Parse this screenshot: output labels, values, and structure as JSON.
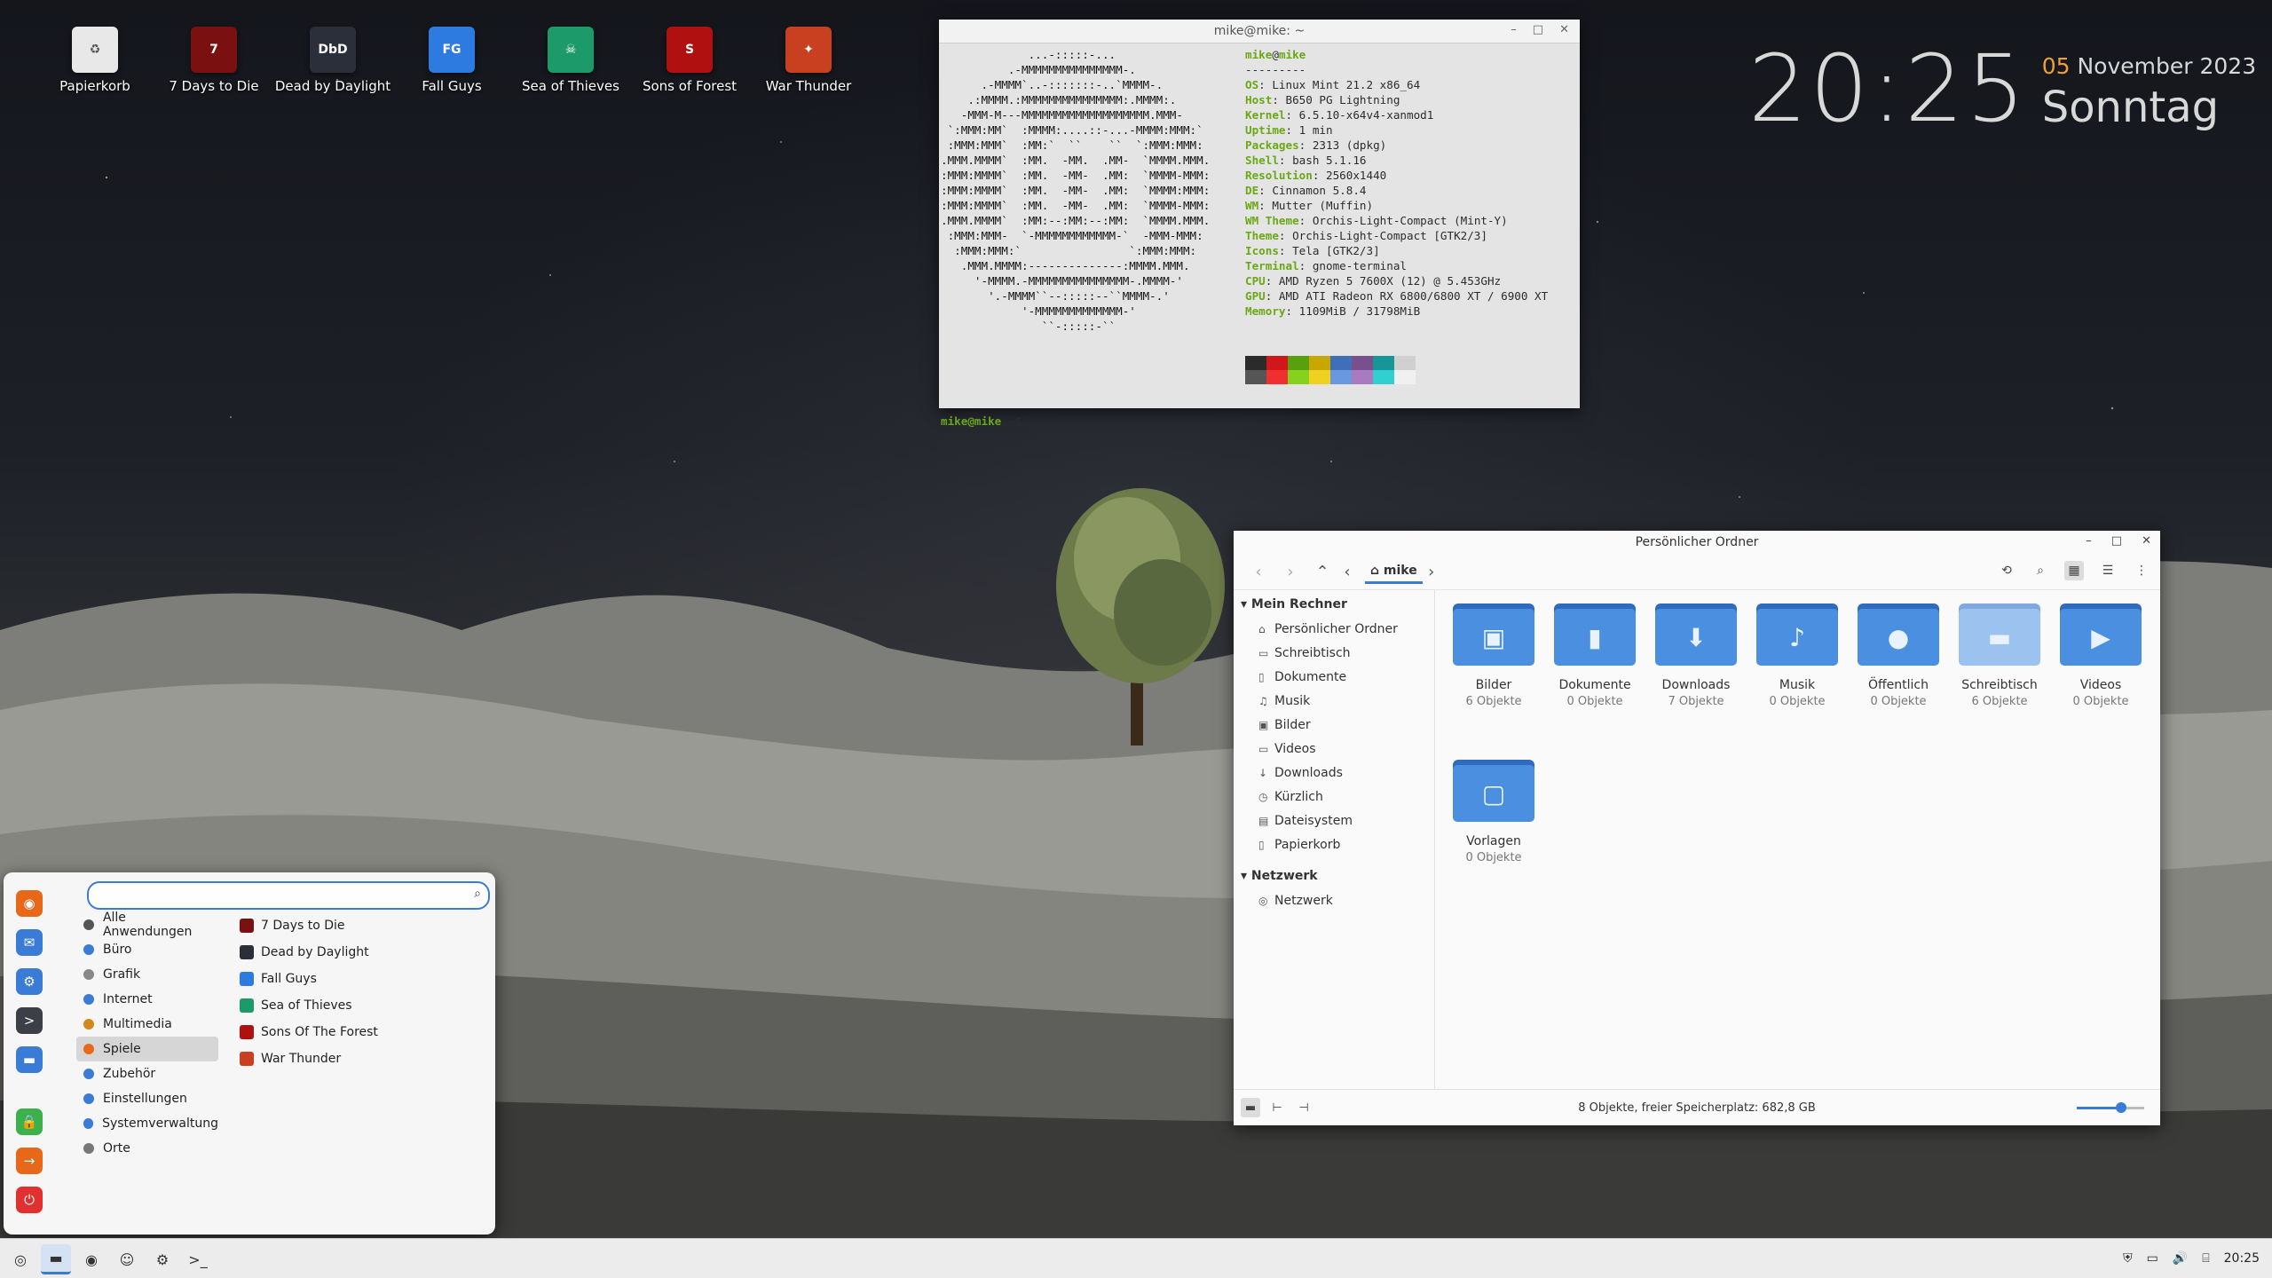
{
  "desktop": {
    "icons": [
      {
        "label": "Papierkorb",
        "color": "#e8e8e8",
        "glyph": "♻"
      },
      {
        "label": "7 Days to Die",
        "color": "#7a1010",
        "glyph": "7"
      },
      {
        "label": "Dead by Daylight",
        "color": "#2a2f3a",
        "glyph": "DbD"
      },
      {
        "label": "Fall Guys",
        "color": "#2d7be0",
        "glyph": "FG"
      },
      {
        "label": "Sea of Thieves",
        "color": "#1c9a6a",
        "glyph": "☠"
      },
      {
        "label": "Sons of Forest",
        "color": "#b01010",
        "glyph": "S"
      },
      {
        "label": "War Thunder",
        "color": "#c84020",
        "glyph": "✦"
      }
    ]
  },
  "clock": {
    "time": "20:25",
    "day_num": "05",
    "month_year": "November 2023",
    "weekday": "Sonntag"
  },
  "terminal": {
    "title": "mike@mike: ~",
    "user": "mike",
    "at": "@",
    "host": "mike",
    "separator": "---------",
    "info": [
      {
        "key": "OS",
        "value": "Linux Mint 21.2 x86_64"
      },
      {
        "key": "Host",
        "value": "B650 PG Lightning"
      },
      {
        "key": "Kernel",
        "value": "6.5.10-x64v4-xanmod1"
      },
      {
        "key": "Uptime",
        "value": "1 min"
      },
      {
        "key": "Packages",
        "value": "2313 (dpkg)"
      },
      {
        "key": "Shell",
        "value": "bash 5.1.16"
      },
      {
        "key": "Resolution",
        "value": "2560x1440"
      },
      {
        "key": "DE",
        "value": "Cinnamon 5.8.4"
      },
      {
        "key": "WM",
        "value": "Mutter (Muffin)"
      },
      {
        "key": "WM Theme",
        "value": "Orchis-Light-Compact (Mint-Y)"
      },
      {
        "key": "Theme",
        "value": "Orchis-Light-Compact [GTK2/3]"
      },
      {
        "key": "Icons",
        "value": "Tela [GTK2/3]"
      },
      {
        "key": "Terminal",
        "value": "gnome-terminal"
      },
      {
        "key": "CPU",
        "value": "AMD Ryzen 5 7600X (12) @ 5.453GHz"
      },
      {
        "key": "GPU",
        "value": "AMD ATI Radeon RX 6800/6800 XT / 6900 XT"
      },
      {
        "key": "Memory",
        "value": "1109MiB / 31798MiB"
      }
    ],
    "ascii": [
      "             ...-:::::-...",
      "          .-MMMMMMMMMMMMMMM-.",
      "      .-MMMM`..-:::::::-..`MMMM-.",
      "    .:MMMM.:MMMMMMMMMMMMMMM:.MMMM:.",
      "   -MMM-M---MMMMMMMMMMMMMMMMMMM.MMM-",
      " `:MMM:MM`  :MMMM:....::-...-MMMM:MMM:`",
      " :MMM:MMM`  :MM:`  ``    ``  `:MMM:MMM:",
      ".MMM.MMMM`  :MM.  -MM.  .MM-  `MMMM.MMM.",
      ":MMM:MMMM`  :MM.  -MM-  .MM:  `MMMM-MMM:",
      ":MMM:MMMM`  :MM.  -MM-  .MM:  `MMMM:MMM:",
      ":MMM:MMMM`  :MM.  -MM-  .MM:  `MMMM-MMM:",
      ".MMM.MMMM`  :MM:--:MM:--:MM:  `MMMM.MMM.",
      " :MMM:MMM-  `-MMMMMMMMMMMM-`  -MMM-MMM:",
      "  :MMM:MMM:`                `:MMM:MMM:",
      "   .MMM.MMMM:--------------:MMMM.MMM.",
      "     '-MMMM.-MMMMMMMMMMMMMMM-.MMMM-'",
      "       '.-MMMM``--:::::--``MMMM-.'",
      "            '-MMMMMMMMMMMMM-'",
      "               ``-:::::-``"
    ],
    "swatches_top": [
      "#2b2b2b",
      "#d01818",
      "#58a00e",
      "#c8a800",
      "#3f6fb8",
      "#7a4f8e",
      "#169696",
      "#d0d0d0"
    ],
    "swatches_bottom": [
      "#555555",
      "#f03030",
      "#86d01e",
      "#f0d020",
      "#6a98e0",
      "#a87ac0",
      "#30d0d0",
      "#f0f0f0"
    ],
    "prompt_user": "mike@mike",
    "prompt_rest": ":~$ _"
  },
  "filemanager": {
    "title": "Persönlicher Ordner",
    "path": "mike",
    "sidebar": {
      "sections": [
        {
          "heading": "Mein Rechner",
          "items": [
            {
              "label": "Persönlicher Ordner",
              "icon": "home-icon",
              "glyph": "⌂"
            },
            {
              "label": "Schreibtisch",
              "icon": "desktop-icon",
              "glyph": "▭"
            },
            {
              "label": "Dokumente",
              "icon": "document-icon",
              "glyph": "▯"
            },
            {
              "label": "Musik",
              "icon": "music-icon",
              "glyph": "♫"
            },
            {
              "label": "Bilder",
              "icon": "image-icon",
              "glyph": "▣"
            },
            {
              "label": "Videos",
              "icon": "video-icon",
              "glyph": "▭"
            },
            {
              "label": "Downloads",
              "icon": "download-icon",
              "glyph": "↓"
            },
            {
              "label": "Kürzlich",
              "icon": "clock-icon",
              "glyph": "◷"
            },
            {
              "label": "Dateisystem",
              "icon": "drive-icon",
              "glyph": "▤"
            },
            {
              "label": "Papierkorb",
              "icon": "trash-icon",
              "glyph": "▯"
            }
          ]
        },
        {
          "heading": "Netzwerk",
          "items": [
            {
              "label": "Netzwerk",
              "icon": "network-icon",
              "glyph": "◎"
            }
          ]
        }
      ]
    },
    "folders": [
      {
        "name": "Bilder",
        "count": "6 Objekte",
        "glyph": "▣",
        "icon": "image-icon",
        "light": false
      },
      {
        "name": "Dokumente",
        "count": "0 Objekte",
        "glyph": "▮",
        "icon": "document-icon",
        "light": false
      },
      {
        "name": "Downloads",
        "count": "7 Objekte",
        "glyph": "⬇",
        "icon": "download-icon",
        "light": false
      },
      {
        "name": "Musik",
        "count": "0 Objekte",
        "glyph": "♪",
        "icon": "music-icon",
        "light": false
      },
      {
        "name": "Öffentlich",
        "count": "0 Objekte",
        "glyph": "●",
        "icon": "person-icon",
        "light": false
      },
      {
        "name": "Schreibtisch",
        "count": "6 Objekte",
        "glyph": "▬",
        "icon": "desktop-icon",
        "light": true
      },
      {
        "name": "Videos",
        "count": "0 Objekte",
        "glyph": "▶",
        "icon": "video-icon",
        "light": false
      },
      {
        "name": "Vorlagen",
        "count": "0 Objekte",
        "glyph": "▢",
        "icon": "template-icon",
        "light": false
      }
    ],
    "status": "8 Objekte, freier Speicherplatz: 682,8 GB",
    "zoom_level": 0.66
  },
  "menu": {
    "search_placeholder": "",
    "side_icons": [
      {
        "name": "firefox-icon",
        "color": "#e8681a",
        "glyph": "◉"
      },
      {
        "name": "mail-icon",
        "color": "#3a7bd5",
        "glyph": "✉"
      },
      {
        "name": "settings-icon",
        "color": "#3a7bd5",
        "glyph": "⚙"
      },
      {
        "name": "terminal-icon",
        "color": "#3c3f46",
        "glyph": ">"
      },
      {
        "name": "files-icon",
        "color": "#3a7bd5",
        "glyph": "▬"
      },
      {
        "name": "lock-icon",
        "color": "#3cb04a",
        "glyph": "🔒"
      },
      {
        "name": "logout-icon",
        "color": "#e8681a",
        "glyph": "→"
      },
      {
        "name": "power-icon",
        "color": "#e03030",
        "glyph": "⏻"
      }
    ],
    "categories": [
      {
        "label": "Alle Anwendungen",
        "color": "#555555"
      },
      {
        "label": "Büro",
        "color": "#3a7bd5"
      },
      {
        "label": "Grafik",
        "color": "#888888"
      },
      {
        "label": "Internet",
        "color": "#3a7bd5"
      },
      {
        "label": "Multimedia",
        "color": "#d08a20"
      },
      {
        "label": "Spiele",
        "color": "#e8681a",
        "selected": true
      },
      {
        "label": "Zubehör",
        "color": "#3a7bd5"
      },
      {
        "label": "Einstellungen",
        "color": "#3a7bd5"
      },
      {
        "label": "Systemverwaltung",
        "color": "#3a7bd5"
      },
      {
        "label": "Orte",
        "color": "#777777"
      }
    ],
    "apps": [
      {
        "label": "7 Days to Die",
        "color": "#7a1010"
      },
      {
        "label": "Dead by Daylight",
        "color": "#2a2f3a"
      },
      {
        "label": "Fall Guys",
        "color": "#2d7be0"
      },
      {
        "label": "Sea of Thieves",
        "color": "#1c9a6a"
      },
      {
        "label": "Sons Of The Forest",
        "color": "#b01010"
      },
      {
        "label": "War Thunder",
        "color": "#c84020"
      }
    ]
  },
  "panel": {
    "clock": "20:25",
    "launchers": [
      {
        "name": "menu-icon",
        "glyph": "◎"
      },
      {
        "name": "files-icon",
        "glyph": "▬"
      },
      {
        "name": "firefox-icon",
        "glyph": "◉"
      },
      {
        "name": "discord-icon",
        "glyph": "☺"
      },
      {
        "name": "steam-icon",
        "glyph": "⚙"
      },
      {
        "name": "terminal-icon",
        "glyph": ">_"
      }
    ],
    "tray": [
      {
        "name": "shield-icon",
        "glyph": "⛨"
      },
      {
        "name": "display-icon",
        "glyph": "▭"
      },
      {
        "name": "volume-icon",
        "glyph": "🔊"
      },
      {
        "name": "network-icon",
        "glyph": "⌸"
      }
    ]
  }
}
